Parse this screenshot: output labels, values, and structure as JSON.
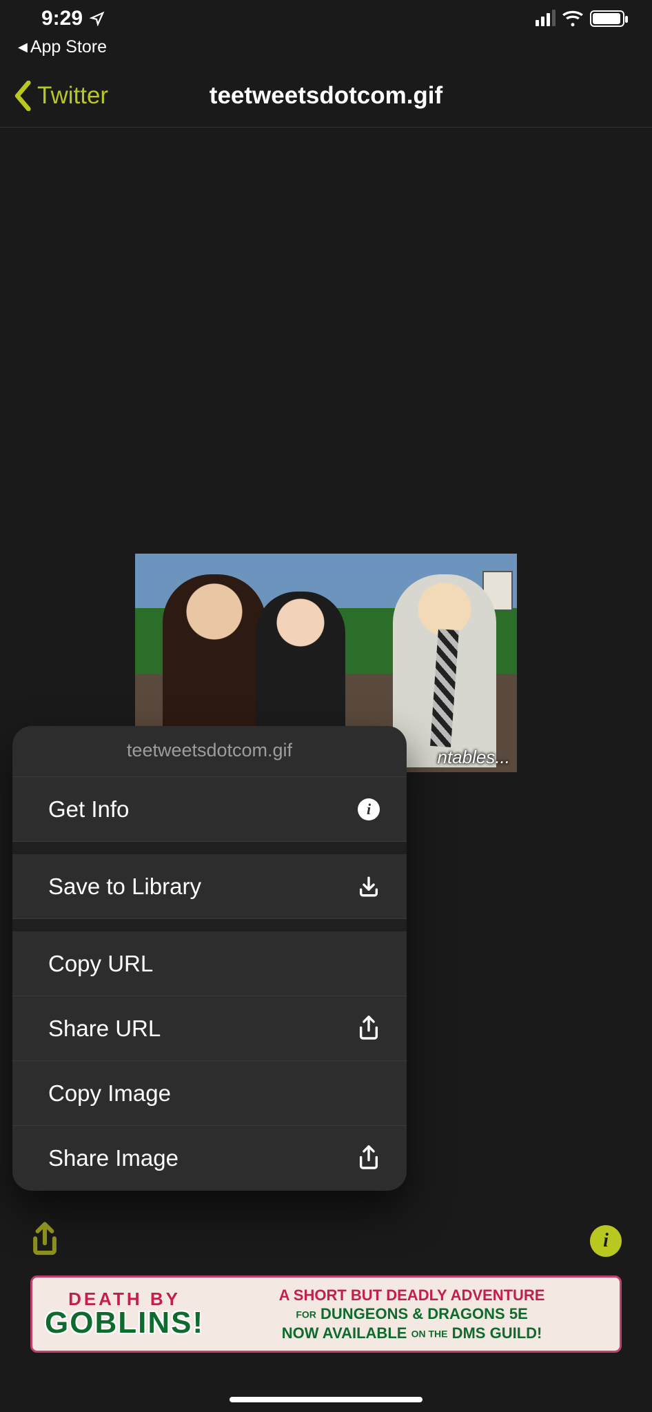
{
  "status": {
    "time": "9:29",
    "back_app": "App Store"
  },
  "nav": {
    "back_label": "Twitter",
    "title": "teetweetsdotcom.gif"
  },
  "image": {
    "caption_visible": "ntables..."
  },
  "menu": {
    "header": "teetweetsdotcom.gif",
    "items": {
      "get_info": "Get Info",
      "save_library": "Save to Library",
      "copy_url": "Copy URL",
      "share_url": "Share URL",
      "copy_image": "Copy Image",
      "share_image": "Share Image"
    }
  },
  "ad": {
    "death_by": "DEATH  BY",
    "goblins": "GOBLINS!",
    "line1": "A SHORT BUT DEADLY ADVENTURE",
    "line2_a": "FOR",
    "line2_b": "DUNGEONS & DRAGONS 5E",
    "line3_a": "NOW AVAILABLE",
    "line3_on": "ON THE",
    "line3_b": "DMS GUILD!"
  }
}
